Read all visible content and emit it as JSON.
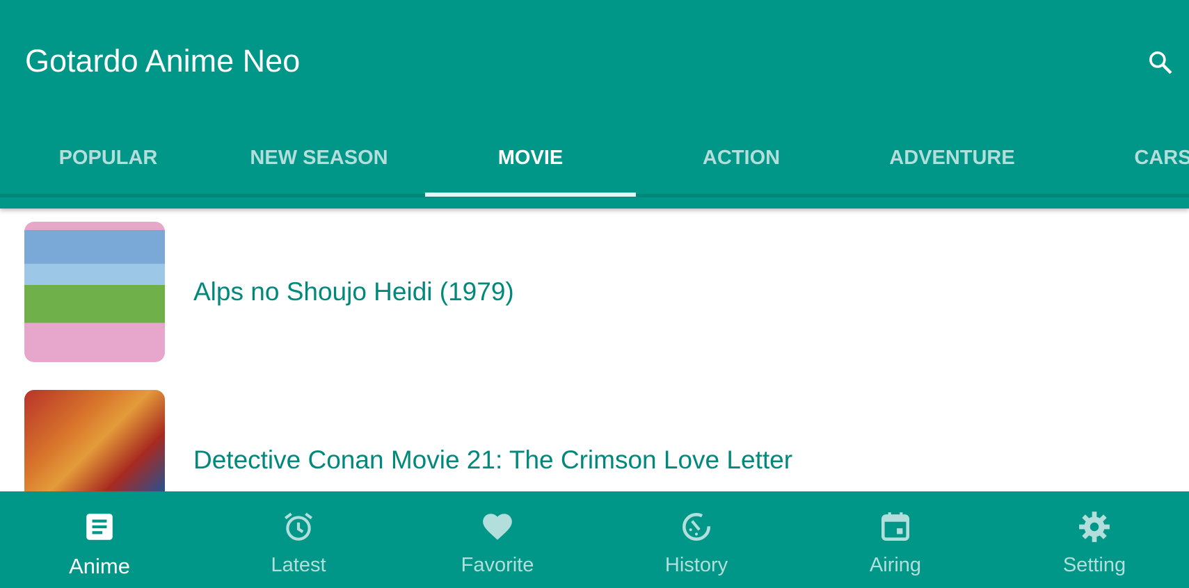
{
  "app_bar": {
    "title": "Gotardo Anime Neo",
    "search_icon": "search-icon"
  },
  "tabs": [
    {
      "label": "POPULAR"
    },
    {
      "label": "NEW SEASON"
    },
    {
      "label": "MOVIE",
      "active": true
    },
    {
      "label": "ACTION"
    },
    {
      "label": "ADVENTURE"
    },
    {
      "label": "CARS"
    }
  ],
  "list": [
    {
      "title": "Alps no Shoujo Heidi (1979)"
    },
    {
      "title": "Detective Conan Movie 21: The Crimson Love Letter"
    }
  ],
  "bottom_nav": [
    {
      "label": "Anime",
      "icon": "article-icon",
      "active": true
    },
    {
      "label": "Latest",
      "icon": "alarm-clock-icon"
    },
    {
      "label": "Favorite",
      "icon": "heart-icon"
    },
    {
      "label": "History",
      "icon": "history-icon"
    },
    {
      "label": "Airing",
      "icon": "calendar-icon"
    },
    {
      "label": "Setting",
      "icon": "gear-icon"
    }
  ],
  "colors": {
    "primary": "#009688",
    "inactive": "#b2dfdb",
    "list_text": "#00897b"
  }
}
